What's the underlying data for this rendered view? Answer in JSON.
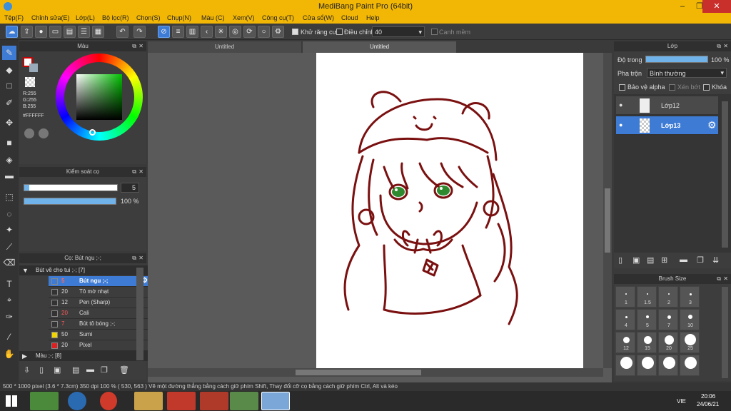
{
  "window": {
    "title": "MediBang Paint Pro (64bit)"
  },
  "menu": [
    "Tệp(F)",
    "Chỉnh sửa(E)",
    "Lớp(L)",
    "Bộ lọc(R)",
    "Chọn(S)",
    "Chụp(N)",
    "Màu (C)",
    "Xem(V)",
    "Công cụ(T)",
    "Cửa sổ(W)",
    "Cloud",
    "Help"
  ],
  "toolbar": {
    "antialias_label": "Khử răng cưa",
    "adjust_label": "Điều chỉnh",
    "adjust_value": "40",
    "edge_label": "Canh mềm"
  },
  "color_panel": {
    "title": "Màu",
    "r": "R:255",
    "g": "G:255",
    "b": "B:255",
    "hex": "#FFFFFF",
    "primary_color": "#cc0000"
  },
  "brush_control": {
    "title": "Kiểm soát cọ",
    "size_value": "5",
    "opacity_value": "100 %",
    "size_fraction": 0.05,
    "opacity_fraction": 1.0
  },
  "brush_panel": {
    "title": "Cọ: Bút ngu ;-;",
    "group1": "Bút vẽ cho tui ;-; [7]",
    "group2": "Màu ;-; [8]",
    "brushes": [
      {
        "size": "5",
        "name": "Bút ngu ;-;",
        "color": "#3d7bd4",
        "selected": true,
        "size_color": "#ff6a5a"
      },
      {
        "size": "20",
        "name": "Tô mờ nhạt",
        "color": "#333333",
        "selected": false,
        "size_color": "#dddddd"
      },
      {
        "size": "12",
        "name": "Pen (Sharp)",
        "color": "#333333",
        "selected": false,
        "size_color": "#dddddd"
      },
      {
        "size": "20",
        "name": "Cali",
        "color": "#333333",
        "selected": false,
        "size_color": "#ff5a5a"
      },
      {
        "size": "7",
        "name": "Bút tô bóng ;-;",
        "color": "#333333",
        "selected": false,
        "size_color": "#ff5a5a"
      },
      {
        "size": "50",
        "name": "Sumi",
        "color": "#f2d600",
        "selected": false,
        "size_color": "#dddddd"
      },
      {
        "size": "20",
        "name": "Pixel",
        "color": "#e02020",
        "selected": false,
        "size_color": "#dddddd"
      }
    ]
  },
  "tabs": [
    "Untitled",
    "Untitled"
  ],
  "layer_panel": {
    "title": "Lớp",
    "opacity_label": "Độ trong",
    "opacity_value": "100 %",
    "blend_label": "Pha trộn",
    "blend_value": "Bình thường",
    "protect_alpha": "Bảo vệ alpha",
    "clipping": "Xén bớt",
    "lock": "Khóa",
    "layers": [
      {
        "name": "Lớp12",
        "selected": false
      },
      {
        "name": "Lớp13",
        "selected": true
      }
    ]
  },
  "brush_size_panel": {
    "title": "Brush Size",
    "sizes": [
      "1",
      "1.5",
      "2",
      "3",
      "4",
      "5",
      "7",
      "10",
      "12",
      "15",
      "20",
      "25",
      "",
      "",
      "",
      ""
    ]
  },
  "status": {
    "text": "500 * 1000 pixel   (3.6 * 7.3cm)   350 dpi   100 %   ( 530, 563 )   Vẽ một đường thẳng bằng cách giữ phím Shift, Thay đổi cỡ cọ bằng cách giữ phím Ctrl, Alt và kéo"
  },
  "taskbar": {
    "time": "20:06",
    "date": "24/06/21",
    "lang": "VIE"
  },
  "colors": {
    "line": "#7a1010",
    "accent": "#3d7bd4",
    "title_bar": "#f2b705"
  }
}
